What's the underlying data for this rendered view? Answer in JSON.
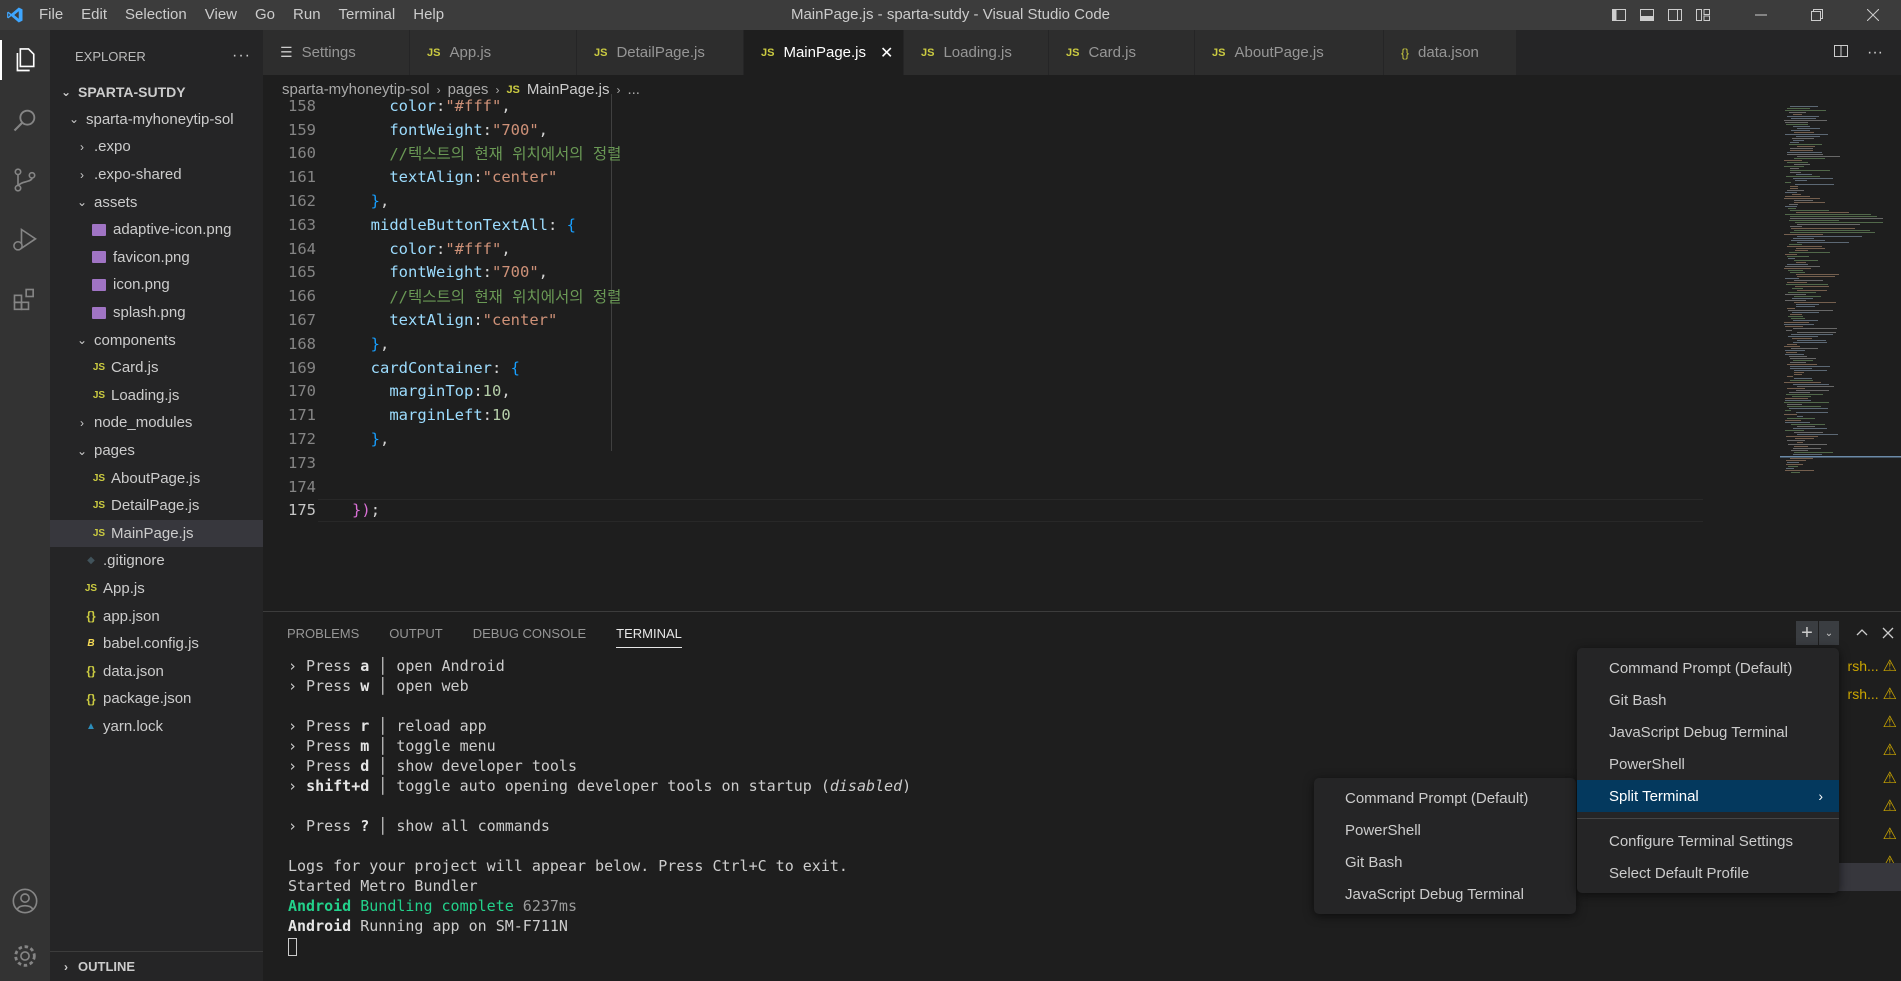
{
  "window": {
    "title": "MainPage.js - sparta-sutdy - Visual Studio Code",
    "menu": [
      "File",
      "Edit",
      "Selection",
      "View",
      "Go",
      "Run",
      "Terminal",
      "Help"
    ]
  },
  "explorer": {
    "header": "EXPLORER",
    "root": "SPARTA-SUTDY",
    "items": [
      {
        "label": "sparta-myhoneytip-sol",
        "type": "folder-open",
        "depth": 1
      },
      {
        "label": ".expo",
        "type": "folder-closed",
        "depth": 2
      },
      {
        "label": ".expo-shared",
        "type": "folder-closed",
        "depth": 2
      },
      {
        "label": "assets",
        "type": "folder-open",
        "depth": 2
      },
      {
        "label": "adaptive-icon.png",
        "type": "image",
        "depth": 3
      },
      {
        "label": "favicon.png",
        "type": "image",
        "depth": 3
      },
      {
        "label": "icon.png",
        "type": "image",
        "depth": 3
      },
      {
        "label": "splash.png",
        "type": "image",
        "depth": 3
      },
      {
        "label": "components",
        "type": "folder-open",
        "depth": 2
      },
      {
        "label": "Card.js",
        "type": "js",
        "depth": 3
      },
      {
        "label": "Loading.js",
        "type": "js",
        "depth": 3
      },
      {
        "label": "node_modules",
        "type": "folder-closed",
        "depth": 2
      },
      {
        "label": "pages",
        "type": "folder-open",
        "depth": 2
      },
      {
        "label": "AboutPage.js",
        "type": "js",
        "depth": 3
      },
      {
        "label": "DetailPage.js",
        "type": "js",
        "depth": 3
      },
      {
        "label": "MainPage.js",
        "type": "js",
        "depth": 3,
        "selected": true
      },
      {
        "label": ".gitignore",
        "type": "git",
        "depth": 2
      },
      {
        "label": "App.js",
        "type": "js",
        "depth": 2
      },
      {
        "label": "app.json",
        "type": "json",
        "depth": 2
      },
      {
        "label": "babel.config.js",
        "type": "babel",
        "depth": 2
      },
      {
        "label": "data.json",
        "type": "json",
        "depth": 2
      },
      {
        "label": "package.json",
        "type": "json",
        "depth": 2
      },
      {
        "label": "yarn.lock",
        "type": "yarn",
        "depth": 2
      }
    ],
    "outline": "OUTLINE"
  },
  "tabs": [
    {
      "label": "Settings",
      "icon": "settings"
    },
    {
      "label": "App.js",
      "icon": "js"
    },
    {
      "label": "DetailPage.js",
      "icon": "js"
    },
    {
      "label": "MainPage.js",
      "icon": "js",
      "active": true
    },
    {
      "label": "Loading.js",
      "icon": "js"
    },
    {
      "label": "Card.js",
      "icon": "js"
    },
    {
      "label": "AboutPage.js",
      "icon": "js"
    },
    {
      "label": "data.json",
      "icon": "json"
    }
  ],
  "breadcrumb": {
    "folder": "sparta-myhoneytip-sol",
    "sub": "pages",
    "file": "MainPage.js",
    "tail": "..."
  },
  "code": {
    "lines": [
      {
        "n": "158",
        "t": [
          [
            "    ",
            "p"
          ],
          [
            "color",
            "k"
          ],
          [
            ":",
            "p"
          ],
          [
            "\"#fff\"",
            "s"
          ],
          [
            ",",
            "p"
          ]
        ]
      },
      {
        "n": "159",
        "t": [
          [
            "    ",
            "p"
          ],
          [
            "fontWeight",
            "k"
          ],
          [
            ":",
            "p"
          ],
          [
            "\"700\"",
            "s"
          ],
          [
            ",",
            "p"
          ]
        ]
      },
      {
        "n": "160",
        "t": [
          [
            "    ",
            "p"
          ],
          [
            "//텍스트의 현재 위치에서의 정렬",
            "c"
          ]
        ]
      },
      {
        "n": "161",
        "t": [
          [
            "    ",
            "p"
          ],
          [
            "textAlign",
            "k"
          ],
          [
            ":",
            "p"
          ],
          [
            "\"center\"",
            "s"
          ]
        ]
      },
      {
        "n": "162",
        "t": [
          [
            "  ",
            "p"
          ],
          [
            "}",
            "b2"
          ],
          [
            ",",
            "p"
          ]
        ]
      },
      {
        "n": "163",
        "t": [
          [
            "  ",
            "p"
          ],
          [
            "middleButtonTextAll",
            "k"
          ],
          [
            ": ",
            "p"
          ],
          [
            "{",
            "b2"
          ]
        ]
      },
      {
        "n": "164",
        "t": [
          [
            "    ",
            "p"
          ],
          [
            "color",
            "k"
          ],
          [
            ":",
            "p"
          ],
          [
            "\"#fff\"",
            "s"
          ],
          [
            ",",
            "p"
          ]
        ]
      },
      {
        "n": "165",
        "t": [
          [
            "    ",
            "p"
          ],
          [
            "fontWeight",
            "k"
          ],
          [
            ":",
            "p"
          ],
          [
            "\"700\"",
            "s"
          ],
          [
            ",",
            "p"
          ]
        ]
      },
      {
        "n": "166",
        "t": [
          [
            "    ",
            "p"
          ],
          [
            "//텍스트의 현재 위치에서의 정렬",
            "c"
          ]
        ]
      },
      {
        "n": "167",
        "t": [
          [
            "    ",
            "p"
          ],
          [
            "textAlign",
            "k"
          ],
          [
            ":",
            "p"
          ],
          [
            "\"center\"",
            "s"
          ]
        ]
      },
      {
        "n": "168",
        "t": [
          [
            "  ",
            "p"
          ],
          [
            "}",
            "b2"
          ],
          [
            ",",
            "p"
          ]
        ]
      },
      {
        "n": "169",
        "t": [
          [
            "  ",
            "p"
          ],
          [
            "cardContainer",
            "k"
          ],
          [
            ": ",
            "p"
          ],
          [
            "{",
            "b2"
          ]
        ]
      },
      {
        "n": "170",
        "t": [
          [
            "    ",
            "p"
          ],
          [
            "marginTop",
            "k"
          ],
          [
            ":",
            "p"
          ],
          [
            "10",
            "n"
          ],
          [
            ",",
            "p"
          ]
        ]
      },
      {
        "n": "171",
        "t": [
          [
            "    ",
            "p"
          ],
          [
            "marginLeft",
            "k"
          ],
          [
            ":",
            "p"
          ],
          [
            "10",
            "n"
          ]
        ]
      },
      {
        "n": "172",
        "t": [
          [
            "  ",
            "p"
          ],
          [
            "}",
            "b2"
          ],
          [
            ",",
            "p"
          ]
        ]
      },
      {
        "n": "173",
        "t": []
      },
      {
        "n": "174",
        "t": []
      },
      {
        "n": "175",
        "t": [
          [
            "}",
            "b1"
          ],
          [
            ")",
            "b1"
          ],
          [
            ";",
            "p"
          ]
        ],
        "current": true
      }
    ]
  },
  "panel": {
    "tabs": [
      "PROBLEMS",
      "OUTPUT",
      "DEBUG CONSOLE",
      "TERMINAL"
    ],
    "active_tab": "TERMINAL",
    "terminal": [
      [
        [
          "› Press ",
          ""
        ],
        [
          "a",
          "tb"
        ],
        [
          " │ open Android",
          ""
        ]
      ],
      [
        [
          "› Press ",
          ""
        ],
        [
          "w",
          "tb"
        ],
        [
          " │ open web",
          ""
        ]
      ],
      [],
      [
        [
          "› Press ",
          ""
        ],
        [
          "r",
          "tb"
        ],
        [
          " │ reload app",
          ""
        ]
      ],
      [
        [
          "› Press ",
          ""
        ],
        [
          "m",
          "tb"
        ],
        [
          " │ toggle menu",
          ""
        ]
      ],
      [
        [
          "› Press ",
          ""
        ],
        [
          "d",
          "tb"
        ],
        [
          " │ show developer tools",
          ""
        ]
      ],
      [
        [
          "› ",
          ""
        ],
        [
          "shift+d",
          "tb"
        ],
        [
          " │ toggle auto opening developer tools on startup (",
          ""
        ],
        [
          "disabled",
          "ti"
        ],
        [
          ")",
          ""
        ]
      ],
      [],
      [
        [
          "› Press ",
          ""
        ],
        [
          "?",
          "tb"
        ],
        [
          " │ show all commands",
          ""
        ]
      ],
      [],
      [
        [
          "Logs for your project will appear below. Press Ctrl+C to exit.",
          ""
        ]
      ],
      [
        [
          "Started Metro Bundler",
          ""
        ]
      ],
      [
        [
          "Android",
          "tg"
        ],
        [
          " ",
          ""
        ],
        [
          "Bundling complete",
          "tg2"
        ],
        [
          " 6237ms",
          "tgray"
        ]
      ],
      [
        [
          "Android",
          "tb"
        ],
        [
          " Running app on SM-F711N",
          ""
        ]
      ]
    ],
    "side_items": [
      {
        "text": "rsh...",
        "warn": true
      },
      {
        "text": "rsh...",
        "warn": true
      },
      {
        "text": "",
        "warn": true
      },
      {
        "text": "",
        "warn": true
      },
      {
        "text": "",
        "warn": true
      },
      {
        "text": "",
        "warn": true
      },
      {
        "text": "",
        "warn": true
      },
      {
        "text": "",
        "warn": true
      }
    ]
  },
  "profile_menu": {
    "items": [
      "Command Prompt (Default)",
      "Git Bash",
      "JavaScript Debug Terminal",
      "PowerShell",
      "Split Terminal"
    ],
    "items2": [
      "Configure Terminal Settings",
      "Select Default Profile"
    ],
    "highlighted": "Split Terminal"
  },
  "split_menu": {
    "items": [
      "Command Prompt (Default)",
      "PowerShell",
      "Git Bash",
      "JavaScript Debug Terminal"
    ]
  },
  "colors": {
    "accent": "#007acc",
    "menu_highlight": "#04395e",
    "warning": "#cca700"
  }
}
